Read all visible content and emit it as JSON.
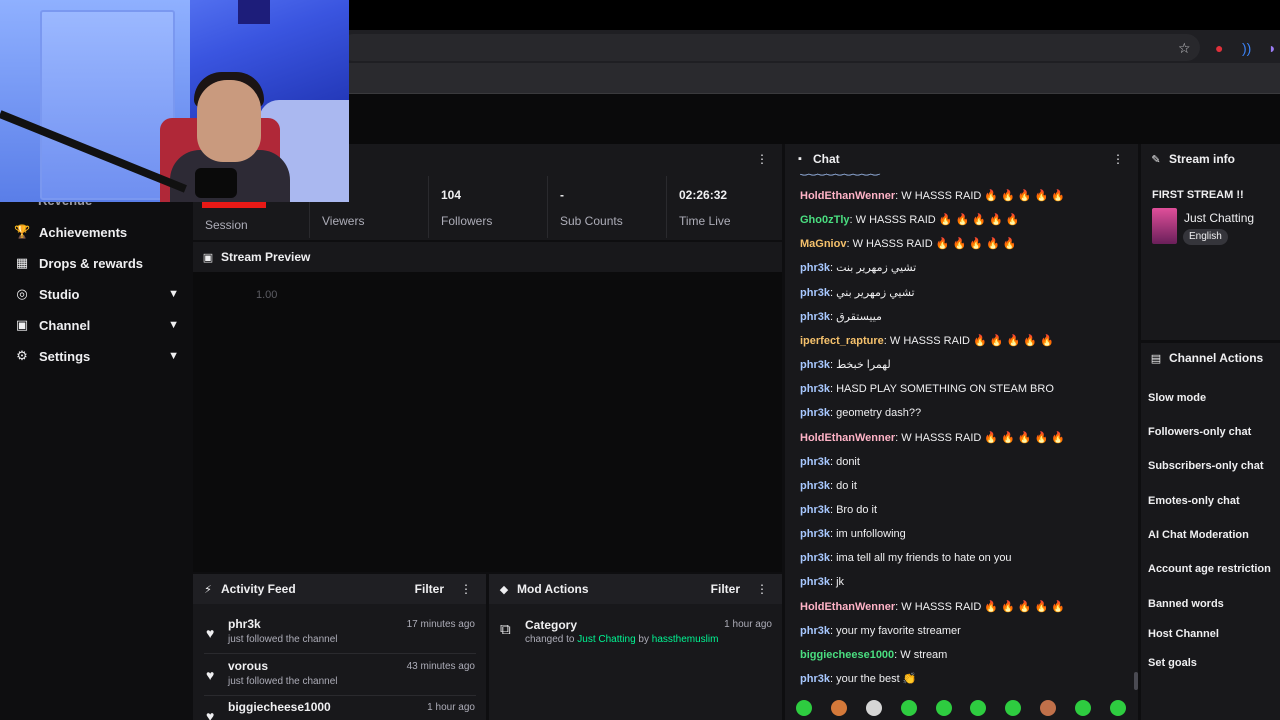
{
  "sidebar": {
    "partial_item": "Revenue",
    "items": [
      {
        "label": "Achievements",
        "icon": "trophy-icon",
        "chevron": false
      },
      {
        "label": "Drops & rewards",
        "icon": "drops-icon",
        "chevron": false
      },
      {
        "label": "Studio",
        "icon": "studio-icon",
        "chevron": true
      },
      {
        "label": "Channel",
        "icon": "channel-icon",
        "chevron": true
      },
      {
        "label": "Settings",
        "icon": "gear-icon",
        "chevron": true
      }
    ]
  },
  "stats": [
    {
      "value": "",
      "label": "Session"
    },
    {
      "value": "",
      "label": "Viewers"
    },
    {
      "value": "104",
      "label": "Followers"
    },
    {
      "value": "-",
      "label": "Sub Counts"
    },
    {
      "value": "02:26:32",
      "label": "Time Live"
    }
  ],
  "preview": {
    "title": "Stream Preview",
    "label": "1.00"
  },
  "activity": {
    "title": "Activity Feed",
    "filter": "Filter",
    "items": [
      {
        "name": "phr3k",
        "action": "just followed the channel",
        "time": "17 minutes ago"
      },
      {
        "name": "vorous",
        "action": "just followed the channel",
        "time": "43 minutes ago"
      },
      {
        "name": "biggiecheese1000",
        "action": "",
        "time": "1 hour ago"
      }
    ]
  },
  "mod": {
    "title": "Mod Actions",
    "filter": "Filter",
    "item": {
      "title": "Category",
      "prefix": "changed to ",
      "category": "Just Chatting",
      "by": " by ",
      "user": "hassthemuslim",
      "time": "1 hour ago"
    }
  },
  "chat": {
    "title": "Chat",
    "messages": [
      {
        "user": "HoldEthanWenner",
        "color": "#ffb3c7",
        "text": ": W HASSS RAID 🔥 🔥 🔥 🔥 🔥"
      },
      {
        "user": "Gho0zTly",
        "color": "#4ade80",
        "text": ": W HASSS RAID 🔥 🔥 🔥 🔥 🔥"
      },
      {
        "user": "MaGniov",
        "color": "#f5c16c",
        "text": ": W HASSS RAID 🔥 🔥 🔥 🔥 🔥"
      },
      {
        "user": "phr3k",
        "color": "#a8c8ff",
        "text": ": تشيي زمهرير بنت"
      },
      {
        "user": "phr3k",
        "color": "#a8c8ff",
        "text": ": تشيي زمهرير بني"
      },
      {
        "user": "phr3k",
        "color": "#a8c8ff",
        "text": ": مييستقرق"
      },
      {
        "user": "iperfect_rapture",
        "color": "#f5c16c",
        "text": ": W HASSS RAID 🔥 🔥 🔥 🔥 🔥"
      },
      {
        "user": "phr3k",
        "color": "#a8c8ff",
        "text": ": لهمرا خبخط"
      },
      {
        "user": "phr3k",
        "color": "#a8c8ff",
        "text": ": HASD PLAY SOMETHING ON STEAM BRO"
      },
      {
        "user": "phr3k",
        "color": "#a8c8ff",
        "text": ": geometry dash??"
      },
      {
        "user": "HoldEthanWenner",
        "color": "#ffb3c7",
        "text": ": W HASSS RAID 🔥 🔥 🔥 🔥 🔥"
      },
      {
        "user": "phr3k",
        "color": "#a8c8ff",
        "text": ": donit"
      },
      {
        "user": "phr3k",
        "color": "#a8c8ff",
        "text": ": do it"
      },
      {
        "user": "phr3k",
        "color": "#a8c8ff",
        "text": ": Bro do it"
      },
      {
        "user": "phr3k",
        "color": "#a8c8ff",
        "text": ": im unfollowing"
      },
      {
        "user": "phr3k",
        "color": "#a8c8ff",
        "text": ": ima tell all my friends to hate on you"
      },
      {
        "user": "phr3k",
        "color": "#a8c8ff",
        "text": ": jk"
      },
      {
        "user": "HoldEthanWenner",
        "color": "#ffb3c7",
        "text": ": W HASSS RAID 🔥 🔥 🔥 🔥 🔥"
      },
      {
        "user": "phr3k",
        "color": "#a8c8ff",
        "text": ": your my favorite streamer"
      },
      {
        "user": "biggiecheese1000",
        "color": "#4ade80",
        "text": ": W stream"
      },
      {
        "user": "phr3k",
        "color": "#a8c8ff",
        "text": ": your the best 👏"
      }
    ]
  },
  "stream_info": {
    "title": "Stream info",
    "stream_title": "FIRST STREAM !!",
    "category": "Just Chatting",
    "tag": "English"
  },
  "channel_actions": {
    "title": "Channel Actions",
    "items": [
      "Slow mode",
      "Followers-only chat",
      "Subscribers-only chat",
      "Emotes-only chat",
      "AI Chat Moderation",
      "Account age restriction",
      "Banned words",
      "Host Channel",
      "Set goals"
    ]
  },
  "colors": {
    "accent_green": "#00f593",
    "bg": "#0e0e10",
    "panel": "#18181b",
    "live_red": "#e91916"
  }
}
